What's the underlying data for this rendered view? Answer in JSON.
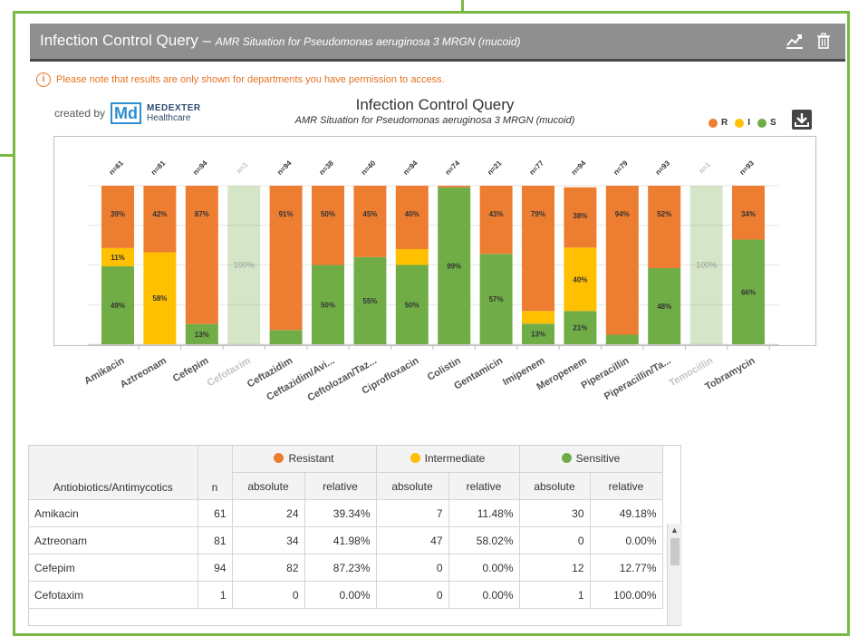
{
  "header": {
    "title": "Infection Control Query",
    "dash": " – ",
    "subtitle": "AMR Situation for Pseudomonas aeruginosa 3 MRGN (mucoid)"
  },
  "notice": "Please note that results are only shown for departments you have permission to access.",
  "brand": {
    "created_by": "created by",
    "logo": "Md",
    "name_1": "MEDEXTER",
    "name_2": "Healthcare"
  },
  "chart_title": "Infection Control Query",
  "chart_subtitle": "AMR Situation for Pseudomonas aeruginosa 3 MRGN (mucoid)",
  "legend": [
    {
      "key": "R",
      "color": "#ed7d31"
    },
    {
      "key": "I",
      "color": "#ffc000"
    },
    {
      "key": "S",
      "color": "#70ad47"
    }
  ],
  "chart_data": {
    "type": "bar",
    "stacked": true,
    "categories": [
      "Amikacin",
      "Aztreonam",
      "Cefepim",
      "Cefotaxim",
      "Ceftazidim",
      "Ceftazidim/Avi...",
      "Ceftolozan/Taz...",
      "Ciprofloxacin",
      "Colistin",
      "Gentamicin",
      "Imipenem",
      "Meropenem",
      "Piperacillin",
      "Piperacillin/Ta...",
      "Temocillin",
      "Tobramycin"
    ],
    "n": [
      61,
      81,
      94,
      1,
      94,
      38,
      40,
      94,
      74,
      21,
      77,
      94,
      79,
      93,
      1,
      93
    ],
    "series": [
      {
        "name": "R",
        "color": "#ed7d31",
        "values": [
          39.34,
          41.98,
          87.23,
          0,
          91,
          50,
          45,
          40,
          1,
          43,
          79,
          38,
          94,
          52,
          0,
          34
        ],
        "labels": [
          "39%",
          "42%",
          "87%",
          "",
          "91%",
          "50%",
          "45%",
          "40%",
          "",
          "43%",
          "79%",
          "38%",
          "94%",
          "52%",
          "",
          "34%"
        ]
      },
      {
        "name": "I",
        "color": "#ffc000",
        "values": [
          11.48,
          58.02,
          0,
          0,
          0,
          0,
          0,
          10,
          0,
          0,
          8,
          40,
          0,
          0,
          0,
          0
        ],
        "labels": [
          "11%",
          "58%",
          "",
          "",
          "",
          "",
          "",
          "",
          "",
          "",
          "",
          "40%",
          "",
          "",
          "",
          ""
        ]
      },
      {
        "name": "S",
        "color": "#70ad47",
        "values": [
          49.18,
          0,
          12.77,
          100,
          9,
          50,
          55,
          50,
          99,
          57,
          13,
          21,
          6,
          48,
          100,
          66
        ],
        "labels": [
          "49%",
          "",
          "13%",
          "100%",
          "",
          "50%",
          "55%",
          "50%",
          "99%",
          "57%",
          "13%",
          "21%",
          "",
          "48%",
          "100%",
          "66%"
        ]
      }
    ],
    "faded": [
      false,
      false,
      false,
      true,
      false,
      false,
      false,
      false,
      false,
      false,
      false,
      false,
      false,
      false,
      true,
      false
    ],
    "ylim": [
      0,
      100
    ],
    "grid": true
  },
  "table": {
    "first_header": "Antiobiotics/Antimycotics",
    "n_header": "n",
    "groups": [
      {
        "label": "Resistant",
        "color": "#ed7d31"
      },
      {
        "label": "Intermediate",
        "color": "#ffc000"
      },
      {
        "label": "Sensitive",
        "color": "#70ad47"
      }
    ],
    "sub_abs": "absolute",
    "sub_rel": "relative",
    "rows": [
      [
        "Amikacin",
        "61",
        "24",
        "39.34%",
        "7",
        "11.48%",
        "30",
        "49.18%"
      ],
      [
        "Aztreonam",
        "81",
        "34",
        "41.98%",
        "47",
        "58.02%",
        "0",
        "0.00%"
      ],
      [
        "Cefepim",
        "94",
        "82",
        "87.23%",
        "0",
        "0.00%",
        "12",
        "12.77%"
      ],
      [
        "Cefotaxim",
        "1",
        "0",
        "0.00%",
        "0",
        "0.00%",
        "1",
        "100.00%"
      ]
    ]
  }
}
